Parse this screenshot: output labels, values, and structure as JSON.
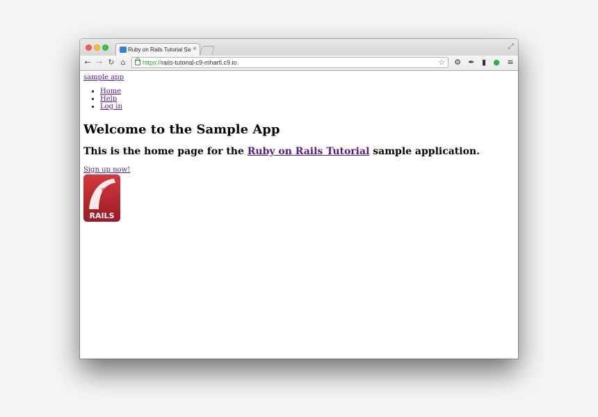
{
  "browser": {
    "tab_title": "Ruby on Rails Tutorial Sam",
    "tab_close": "×",
    "url_scheme": "https://",
    "url_rest": "rails-tutorial-c9-mhartl.c9.io"
  },
  "page": {
    "logo_text": "sample app",
    "nav": [
      "Home",
      "Help",
      "Log in"
    ],
    "heading": "Welcome to the Sample App",
    "subheading_before": "This is the home page for the ",
    "subheading_link": "Ruby on Rails Tutorial",
    "subheading_after": " sample application.",
    "signup_link": "Sign up now!",
    "rails_logo_text": "RAILS"
  },
  "colors": {
    "link": "#551a8b",
    "secure": "#2a9d3a",
    "rails_red": "#b3202a"
  }
}
